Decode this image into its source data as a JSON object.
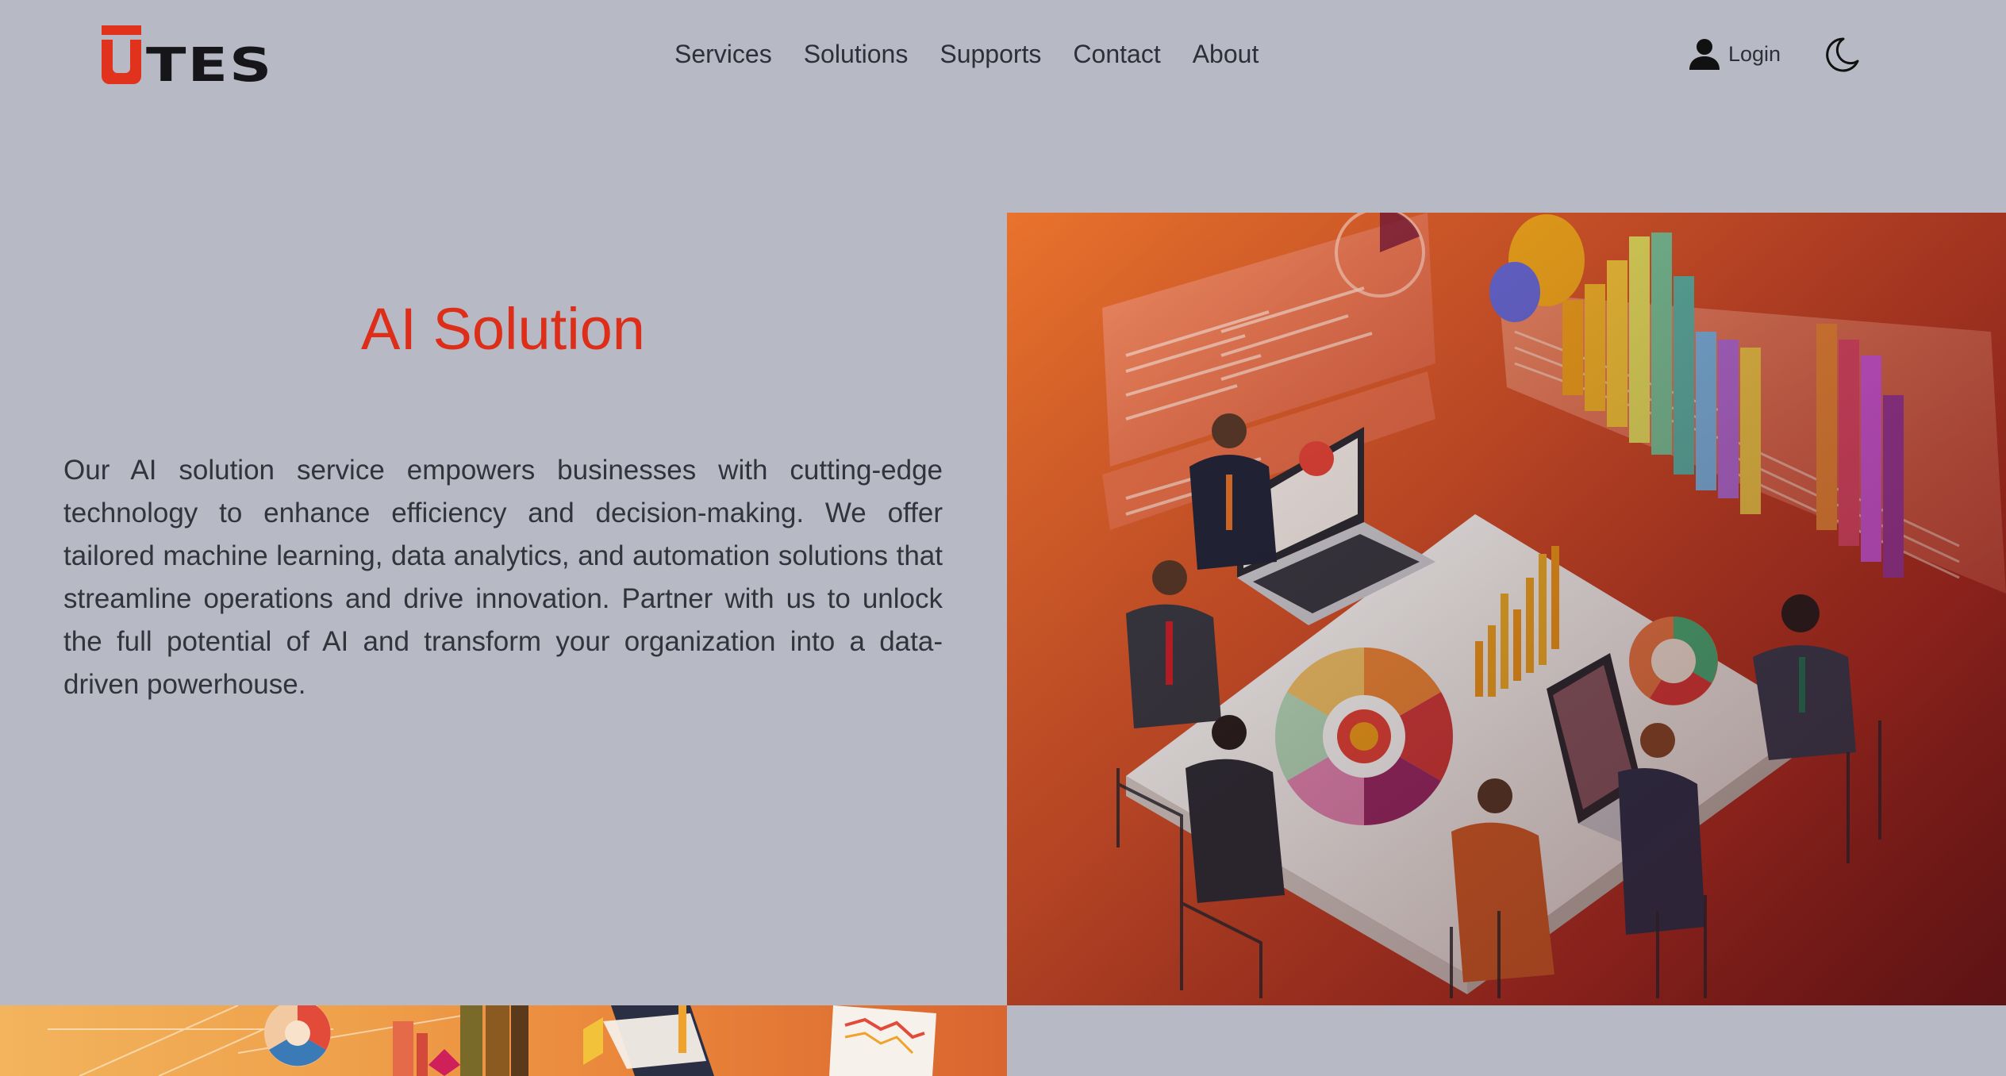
{
  "brand": {
    "logo_text": "TES",
    "logo_full": "UTES",
    "accent_color": "#e0321c"
  },
  "nav": {
    "items": [
      {
        "label": "Services"
      },
      {
        "label": "Solutions"
      },
      {
        "label": "Supports"
      },
      {
        "label": "Contact"
      },
      {
        "label": "About"
      }
    ]
  },
  "header": {
    "login_label": "Login",
    "login_icon": "user-icon",
    "theme_icon": "moon-icon"
  },
  "hero": {
    "title": "AI Solution",
    "description": "Our AI solution service empowers businesses with cutting-edge technology to enhance efficiency and decision-making. We offer tailored machine learning, data analytics, and automation solutions that streamline operations and drive innovation. Partner with us to unlock the full potential of AI and transform your organization into a data-driven powerhouse.",
    "title_color": "#dc2e18"
  },
  "colors": {
    "page_background": "#b7b9c5",
    "text": "#32333b"
  }
}
